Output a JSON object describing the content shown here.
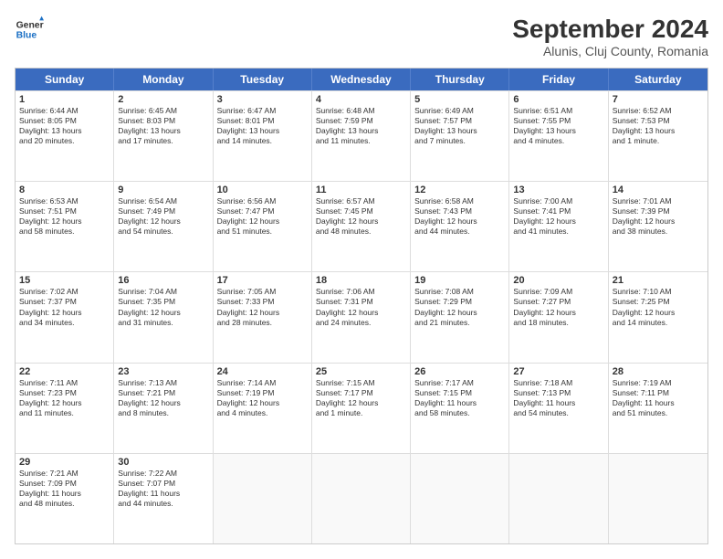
{
  "header": {
    "logo_line1": "General",
    "logo_line2": "Blue",
    "main_title": "September 2024",
    "sub_title": "Alunis, Cluj County, Romania"
  },
  "days_of_week": [
    "Sunday",
    "Monday",
    "Tuesday",
    "Wednesday",
    "Thursday",
    "Friday",
    "Saturday"
  ],
  "rows": [
    [
      {
        "day": "1",
        "lines": [
          "Sunrise: 6:44 AM",
          "Sunset: 8:05 PM",
          "Daylight: 13 hours",
          "and 20 minutes."
        ]
      },
      {
        "day": "2",
        "lines": [
          "Sunrise: 6:45 AM",
          "Sunset: 8:03 PM",
          "Daylight: 13 hours",
          "and 17 minutes."
        ]
      },
      {
        "day": "3",
        "lines": [
          "Sunrise: 6:47 AM",
          "Sunset: 8:01 PM",
          "Daylight: 13 hours",
          "and 14 minutes."
        ]
      },
      {
        "day": "4",
        "lines": [
          "Sunrise: 6:48 AM",
          "Sunset: 7:59 PM",
          "Daylight: 13 hours",
          "and 11 minutes."
        ]
      },
      {
        "day": "5",
        "lines": [
          "Sunrise: 6:49 AM",
          "Sunset: 7:57 PM",
          "Daylight: 13 hours",
          "and 7 minutes."
        ]
      },
      {
        "day": "6",
        "lines": [
          "Sunrise: 6:51 AM",
          "Sunset: 7:55 PM",
          "Daylight: 13 hours",
          "and 4 minutes."
        ]
      },
      {
        "day": "7",
        "lines": [
          "Sunrise: 6:52 AM",
          "Sunset: 7:53 PM",
          "Daylight: 13 hours",
          "and 1 minute."
        ]
      }
    ],
    [
      {
        "day": "8",
        "lines": [
          "Sunrise: 6:53 AM",
          "Sunset: 7:51 PM",
          "Daylight: 12 hours",
          "and 58 minutes."
        ]
      },
      {
        "day": "9",
        "lines": [
          "Sunrise: 6:54 AM",
          "Sunset: 7:49 PM",
          "Daylight: 12 hours",
          "and 54 minutes."
        ]
      },
      {
        "day": "10",
        "lines": [
          "Sunrise: 6:56 AM",
          "Sunset: 7:47 PM",
          "Daylight: 12 hours",
          "and 51 minutes."
        ]
      },
      {
        "day": "11",
        "lines": [
          "Sunrise: 6:57 AM",
          "Sunset: 7:45 PM",
          "Daylight: 12 hours",
          "and 48 minutes."
        ]
      },
      {
        "day": "12",
        "lines": [
          "Sunrise: 6:58 AM",
          "Sunset: 7:43 PM",
          "Daylight: 12 hours",
          "and 44 minutes."
        ]
      },
      {
        "day": "13",
        "lines": [
          "Sunrise: 7:00 AM",
          "Sunset: 7:41 PM",
          "Daylight: 12 hours",
          "and 41 minutes."
        ]
      },
      {
        "day": "14",
        "lines": [
          "Sunrise: 7:01 AM",
          "Sunset: 7:39 PM",
          "Daylight: 12 hours",
          "and 38 minutes."
        ]
      }
    ],
    [
      {
        "day": "15",
        "lines": [
          "Sunrise: 7:02 AM",
          "Sunset: 7:37 PM",
          "Daylight: 12 hours",
          "and 34 minutes."
        ]
      },
      {
        "day": "16",
        "lines": [
          "Sunrise: 7:04 AM",
          "Sunset: 7:35 PM",
          "Daylight: 12 hours",
          "and 31 minutes."
        ]
      },
      {
        "day": "17",
        "lines": [
          "Sunrise: 7:05 AM",
          "Sunset: 7:33 PM",
          "Daylight: 12 hours",
          "and 28 minutes."
        ]
      },
      {
        "day": "18",
        "lines": [
          "Sunrise: 7:06 AM",
          "Sunset: 7:31 PM",
          "Daylight: 12 hours",
          "and 24 minutes."
        ]
      },
      {
        "day": "19",
        "lines": [
          "Sunrise: 7:08 AM",
          "Sunset: 7:29 PM",
          "Daylight: 12 hours",
          "and 21 minutes."
        ]
      },
      {
        "day": "20",
        "lines": [
          "Sunrise: 7:09 AM",
          "Sunset: 7:27 PM",
          "Daylight: 12 hours",
          "and 18 minutes."
        ]
      },
      {
        "day": "21",
        "lines": [
          "Sunrise: 7:10 AM",
          "Sunset: 7:25 PM",
          "Daylight: 12 hours",
          "and 14 minutes."
        ]
      }
    ],
    [
      {
        "day": "22",
        "lines": [
          "Sunrise: 7:11 AM",
          "Sunset: 7:23 PM",
          "Daylight: 12 hours",
          "and 11 minutes."
        ]
      },
      {
        "day": "23",
        "lines": [
          "Sunrise: 7:13 AM",
          "Sunset: 7:21 PM",
          "Daylight: 12 hours",
          "and 8 minutes."
        ]
      },
      {
        "day": "24",
        "lines": [
          "Sunrise: 7:14 AM",
          "Sunset: 7:19 PM",
          "Daylight: 12 hours",
          "and 4 minutes."
        ]
      },
      {
        "day": "25",
        "lines": [
          "Sunrise: 7:15 AM",
          "Sunset: 7:17 PM",
          "Daylight: 12 hours",
          "and 1 minute."
        ]
      },
      {
        "day": "26",
        "lines": [
          "Sunrise: 7:17 AM",
          "Sunset: 7:15 PM",
          "Daylight: 11 hours",
          "and 58 minutes."
        ]
      },
      {
        "day": "27",
        "lines": [
          "Sunrise: 7:18 AM",
          "Sunset: 7:13 PM",
          "Daylight: 11 hours",
          "and 54 minutes."
        ]
      },
      {
        "day": "28",
        "lines": [
          "Sunrise: 7:19 AM",
          "Sunset: 7:11 PM",
          "Daylight: 11 hours",
          "and 51 minutes."
        ]
      }
    ],
    [
      {
        "day": "29",
        "lines": [
          "Sunrise: 7:21 AM",
          "Sunset: 7:09 PM",
          "Daylight: 11 hours",
          "and 48 minutes."
        ]
      },
      {
        "day": "30",
        "lines": [
          "Sunrise: 7:22 AM",
          "Sunset: 7:07 PM",
          "Daylight: 11 hours",
          "and 44 minutes."
        ]
      },
      {
        "day": "",
        "lines": []
      },
      {
        "day": "",
        "lines": []
      },
      {
        "day": "",
        "lines": []
      },
      {
        "day": "",
        "lines": []
      },
      {
        "day": "",
        "lines": []
      }
    ]
  ]
}
